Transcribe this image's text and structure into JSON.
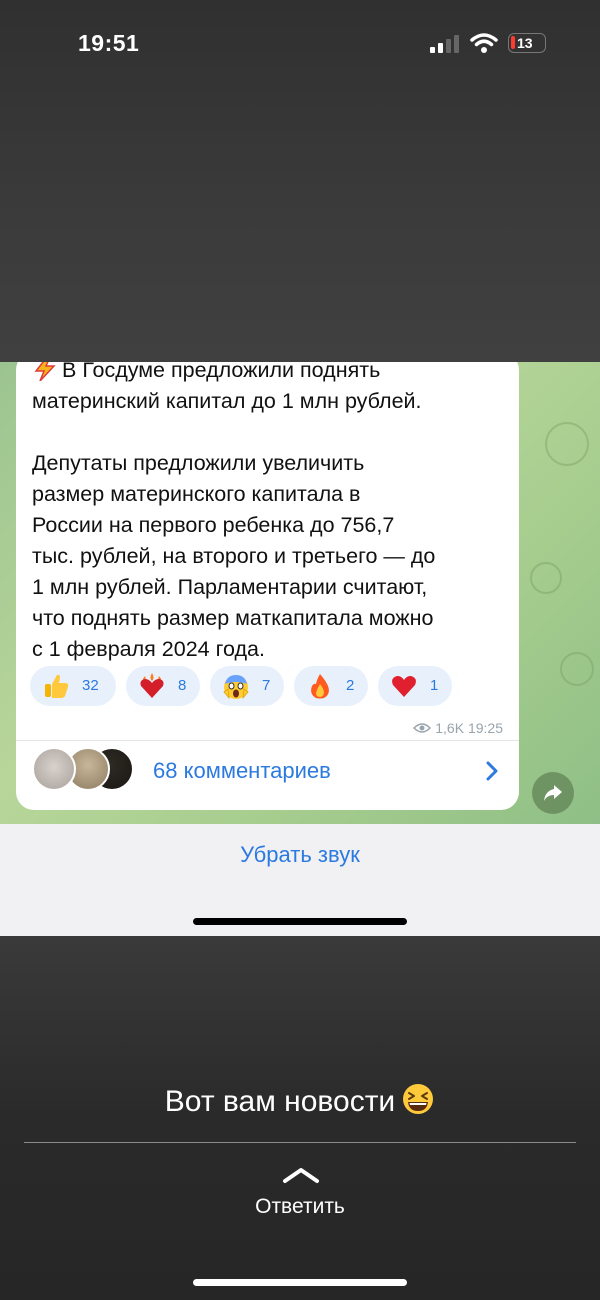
{
  "status_bar": {
    "time": "19:51",
    "battery": "13"
  },
  "message": {
    "lines": [
      "В Госдуме предложили поднять",
      "материнский капитал до 1 млн рублей.",
      "",
      "Депутаты предложили увеличить",
      "размер материнского капитала в",
      "России на первого ребенка до 756,7",
      "тыс. рублей, на второго и третьего — до",
      "1 млн рублей. Парламентарии считают,",
      "что поднять размер маткапитала можно",
      "с 1 февраля 2024 года."
    ],
    "reactions": [
      {
        "emoji": "thumbs-up",
        "count": "32"
      },
      {
        "emoji": "heart-on-fire",
        "count": "8"
      },
      {
        "emoji": "screaming-face",
        "count": "7"
      },
      {
        "emoji": "fire",
        "count": "2"
      },
      {
        "emoji": "red-heart",
        "count": "1"
      }
    ],
    "views": "1,6K",
    "time": "19:25",
    "comments_label": "68 комментариев"
  },
  "mute_label": "Убрать звук",
  "story": {
    "caption": "Вот вам новости",
    "reply_label": "Ответить"
  },
  "colors": {
    "accent": "#2b7ae0",
    "reaction_bg": "#e8f1fb",
    "chat_bg": "#a5cc8e"
  }
}
